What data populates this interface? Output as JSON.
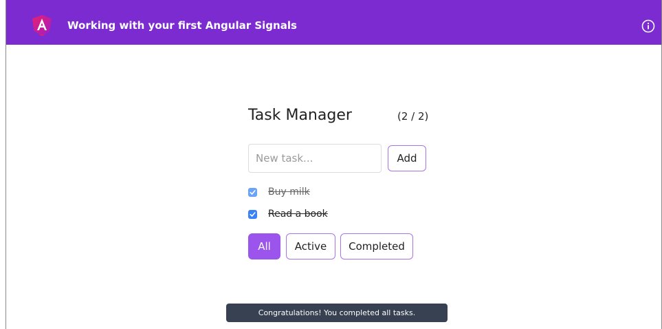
{
  "header": {
    "title": "Working with your first Angular Signals",
    "logo_icon": "angular-logo-icon",
    "info_icon": "info-icon",
    "background_color": "#7b2bd0"
  },
  "task_manager": {
    "title": "Task Manager",
    "counter": "(2 / 2)",
    "new_task_input": {
      "value": "",
      "placeholder": "New task..."
    },
    "add_label": "Add",
    "tasks": [
      {
        "label": "Buy milk",
        "completed": true
      },
      {
        "label": "Read a book",
        "completed": true
      }
    ],
    "filters": [
      {
        "label": "All",
        "selected": true
      },
      {
        "label": "Active",
        "selected": false
      },
      {
        "label": "Completed",
        "selected": false
      }
    ],
    "accent_color": "#9b55ec"
  },
  "toast": {
    "message": "Congratulations! You completed all tasks."
  }
}
